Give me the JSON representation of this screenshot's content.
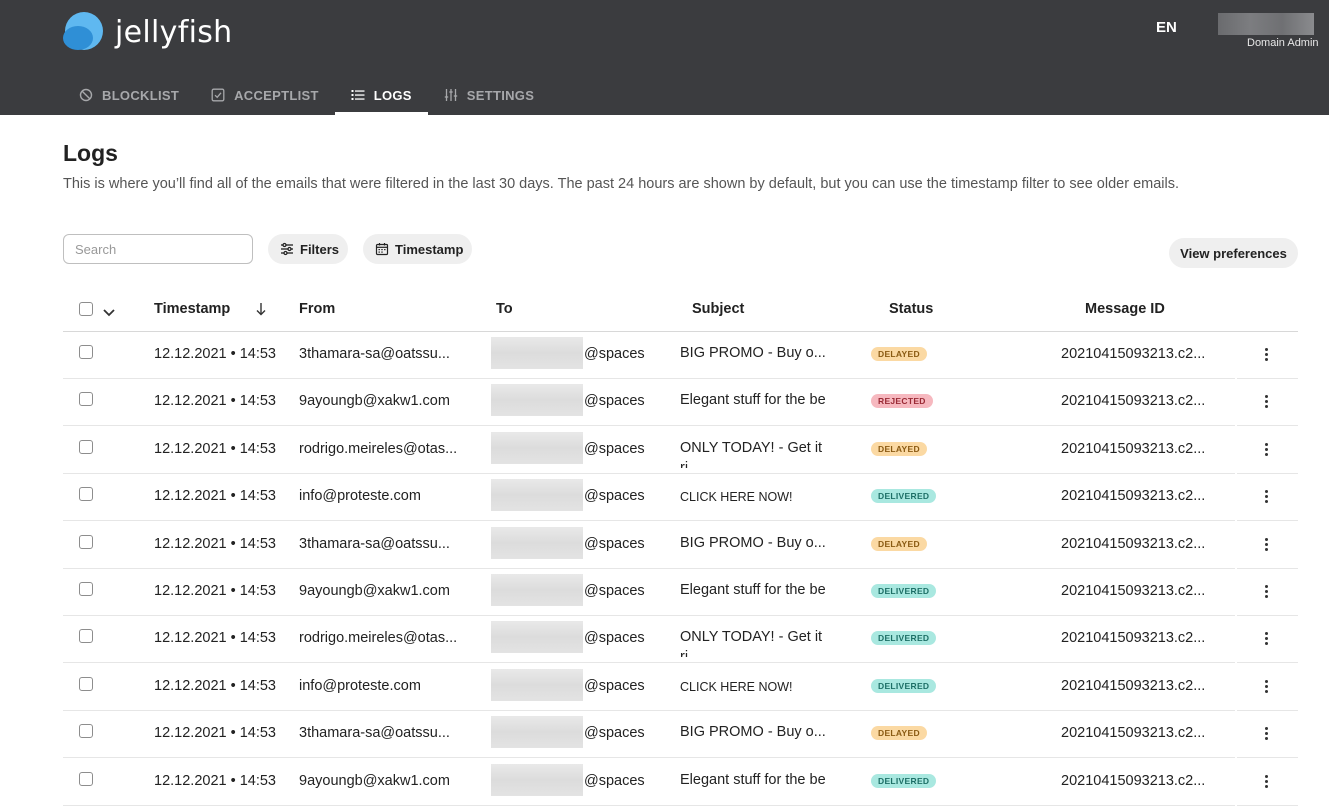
{
  "app": {
    "name": "jellyfish",
    "lang": "EN",
    "user_role": "Domain Admin"
  },
  "nav": {
    "items": [
      {
        "label": "BLOCKLIST",
        "icon": "blocked-circle-icon",
        "active": false
      },
      {
        "label": "ACCEPTLIST",
        "icon": "checkbox-check-icon",
        "active": false
      },
      {
        "label": "LOGS",
        "icon": "list-icon",
        "active": true
      },
      {
        "label": "SETTINGS",
        "icon": "sliders-icon",
        "active": false
      }
    ]
  },
  "page": {
    "title": "Logs",
    "description": "This is where you’ll find all of  the emails that were filtered in the last 30 days. The past 24 hours are shown by default, but you can use the timestamp filter to see older emails."
  },
  "toolbar": {
    "search_placeholder": "Search",
    "filters_label": "Filters",
    "timestamp_label": "Timestamp",
    "view_preferences_label": "View preferences"
  },
  "table": {
    "headers": {
      "timestamp": "Timestamp",
      "from": "From",
      "to": "To",
      "subject": "Subject",
      "status": "Status",
      "message_id": "Message ID"
    },
    "rows": [
      {
        "timestamp": "12.12.2021 • 14:53",
        "from": "3thamara-sa@oatssu...",
        "to": "@spaces",
        "subject": "BIG PROMO - Buy o...",
        "subject_small": false,
        "status": "DELAYED",
        "message_id": "20210415093213.c2..."
      },
      {
        "timestamp": "12.12.2021 • 14:53",
        "from": "9ayoungb@xakw1.com",
        "to": "@spaces",
        "subject": "Elegant stuff for the be",
        "subject_small": false,
        "status": "REJECTED",
        "message_id": "20210415093213.c2..."
      },
      {
        "timestamp": "12.12.2021 • 14:53",
        "from": "rodrigo.meireles@otas...",
        "to": "@spaces",
        "subject": "ONLY TODAY! - Get it ri",
        "subject_small": false,
        "status": "DELAYED",
        "message_id": "20210415093213.c2..."
      },
      {
        "timestamp": "12.12.2021 • 14:53",
        "from": "info@proteste.com",
        "to": "@spaces",
        "subject": "CLICK HERE NOW!",
        "subject_small": true,
        "status": "DELIVERED",
        "message_id": "20210415093213.c2..."
      },
      {
        "timestamp": "12.12.2021 • 14:53",
        "from": "3thamara-sa@oatssu...",
        "to": "@spaces",
        "subject": "BIG PROMO - Buy o...",
        "subject_small": false,
        "status": "DELAYED",
        "message_id": "20210415093213.c2..."
      },
      {
        "timestamp": "12.12.2021 • 14:53",
        "from": "9ayoungb@xakw1.com",
        "to": "@spaces",
        "subject": "Elegant stuff for the be",
        "subject_small": false,
        "status": "DELIVERED",
        "message_id": "20210415093213.c2..."
      },
      {
        "timestamp": "12.12.2021 • 14:53",
        "from": "rodrigo.meireles@otas...",
        "to": "@spaces",
        "subject": "ONLY TODAY! - Get it ri",
        "subject_small": false,
        "status": "DELIVERED",
        "message_id": "20210415093213.c2..."
      },
      {
        "timestamp": "12.12.2021 • 14:53",
        "from": "info@proteste.com",
        "to": "@spaces",
        "subject": "CLICK HERE NOW!",
        "subject_small": true,
        "status": "DELIVERED",
        "message_id": "20210415093213.c2..."
      },
      {
        "timestamp": "12.12.2021 • 14:53",
        "from": "3thamara-sa@oatssu...",
        "to": "@spaces",
        "subject": "BIG PROMO - Buy o...",
        "subject_small": false,
        "status": "DELAYED",
        "message_id": "20210415093213.c2..."
      },
      {
        "timestamp": "12.12.2021 • 14:53",
        "from": "9ayoungb@xakw1.com",
        "to": "@spaces",
        "subject": "Elegant stuff for the be",
        "subject_small": false,
        "status": "DELIVERED",
        "message_id": "20210415093213.c2..."
      }
    ]
  },
  "status_colors": {
    "DELAYED": {
      "bg": "#fbd9a3",
      "fg": "#8a5a12"
    },
    "REJECTED": {
      "bg": "#f6b8bf",
      "fg": "#9a2a35"
    },
    "DELIVERED": {
      "bg": "#a9e8e0",
      "fg": "#1d6f66"
    }
  },
  "colors": {
    "header_bg": "#3b3c3f",
    "logo_light": "#5fb8f0",
    "logo_dark": "#2f8fd6"
  }
}
